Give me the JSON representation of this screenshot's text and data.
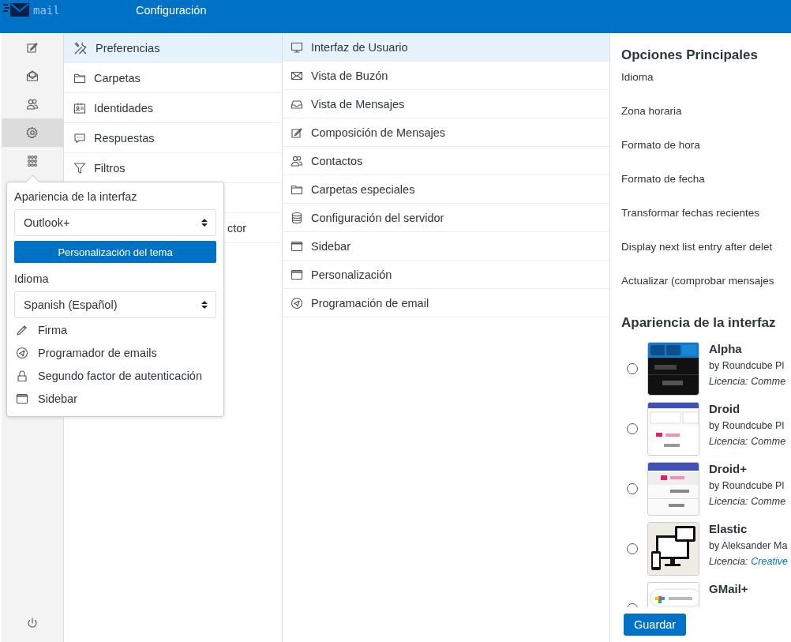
{
  "header": {
    "logo_text": "mail",
    "title": "Configuración"
  },
  "nav": [
    {
      "selected": false
    },
    {
      "selected": false
    },
    {
      "selected": false
    },
    {
      "selected": true
    },
    {
      "selected": false
    }
  ],
  "sections": [
    {
      "label": "Preferencias",
      "selected": true
    },
    {
      "label": "Carpetas",
      "selected": false
    },
    {
      "label": "Identidades",
      "selected": false
    },
    {
      "label": "Respuestas",
      "selected": false
    },
    {
      "label": "Filtros",
      "selected": false
    },
    {
      "label": "ctor",
      "selected": false
    }
  ],
  "preferences": [
    {
      "label": "Interfaz de Usuario",
      "selected": true
    },
    {
      "label": "Vista de Buzón",
      "selected": false
    },
    {
      "label": "Vista de Mensajes",
      "selected": false
    },
    {
      "label": "Composición de Mensajes",
      "selected": false
    },
    {
      "label": "Contactos",
      "selected": false
    },
    {
      "label": "Carpetas especiales",
      "selected": false
    },
    {
      "label": "Configuración del servidor",
      "selected": false
    },
    {
      "label": "Sidebar",
      "selected": false
    },
    {
      "label": "Personalización",
      "selected": false
    },
    {
      "label": "Programación de email",
      "selected": false
    }
  ],
  "settings": {
    "heading": "Opciones Principales",
    "options": [
      "Idioma",
      "Zona horaria",
      "Formato de hora",
      "Formato de fecha",
      "Transformar fechas recientes",
      "Display next list entry after delet",
      "Actualizar (comprobar mensajes"
    ],
    "skins_heading": "Apariencia de la interfaz",
    "skins": [
      {
        "name": "Alpha",
        "author": "by Roundcube Pl",
        "license_label": "Licencia:",
        "license": "Comme",
        "link": false,
        "selected": false
      },
      {
        "name": "Droid",
        "author": "by Roundcube Pl",
        "license_label": "Licencia:",
        "license": "Comme",
        "link": false,
        "selected": false
      },
      {
        "name": "Droid+",
        "author": "by Roundcube Pl",
        "license_label": "Licencia:",
        "license": "Comme",
        "link": false,
        "selected": false
      },
      {
        "name": "Elastic",
        "author": "by Aleksander Ma",
        "license_label": "Licencia:",
        "license": "Creative",
        "link": true,
        "selected": false
      },
      {
        "name": "GMail+",
        "selected": false
      }
    ],
    "save_button": "Guardar"
  },
  "popover": {
    "skin_label": "Apariencia de la interfaz",
    "skin_value": "Outlook+",
    "theme_button": "Personalización del tema",
    "language_label": "Idioma",
    "language_value": "Spanish (Español)",
    "links": [
      "Firma",
      "Programador de emails",
      "Segundo factor de autenticación",
      "Sidebar"
    ]
  }
}
